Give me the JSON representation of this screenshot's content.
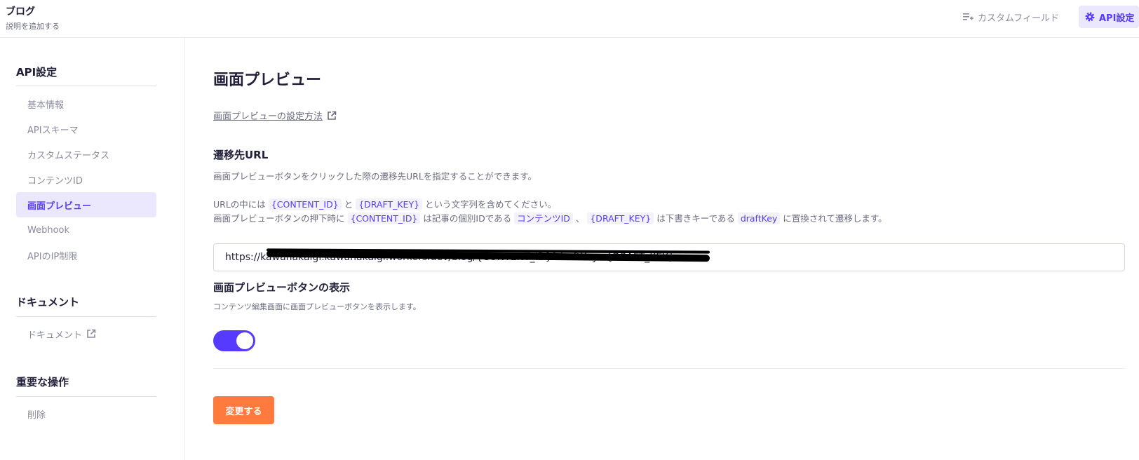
{
  "header": {
    "app_title": "ブログ",
    "app_desc": "説明を追加する",
    "custom_field_label": "カスタムフィールド",
    "api_settings_label": "API設定"
  },
  "sidebar": {
    "sections": [
      {
        "title": "API設定",
        "items": [
          {
            "label": "基本情報",
            "active": false
          },
          {
            "label": "APIスキーマ",
            "active": false
          },
          {
            "label": "カスタムステータス",
            "active": false
          },
          {
            "label": "コンテンツID",
            "active": false
          },
          {
            "label": "画面プレビュー",
            "active": true
          },
          {
            "label": "Webhook",
            "active": false
          },
          {
            "label": "APIのIP制限",
            "active": false
          }
        ]
      },
      {
        "title": "ドキュメント",
        "items": [
          {
            "label": "ドキュメント",
            "active": false,
            "external": true
          }
        ]
      },
      {
        "title": "重要な操作",
        "items": [
          {
            "label": "削除",
            "active": false
          }
        ]
      }
    ]
  },
  "main": {
    "page_title": "画面プレビュー",
    "help_link": "画面プレビューの設定方法",
    "url_section": {
      "title": "遷移先URL",
      "desc": "画面プレビューボタンをクリックした際の遷移先URLを指定することができます。",
      "note1_prefix": "URLの中には",
      "content_id_token": "{CONTENT_ID}",
      "and": "と",
      "draft_key_token": "{DRAFT_KEY}",
      "note1_suffix": "という文字列を含めてください。",
      "note2_prefix": "画面プレビューボタンの押下時に",
      "note2_mid1": "は記事の個別IDである",
      "content_id_label": "コンテンツID",
      "comma": "、",
      "note2_mid2": "は下書きキーである",
      "draft_key_label": "draftKey",
      "note2_suffix": "に置換されて遷移します。",
      "url_value": "https://kawanakaigi.kawanakaigi.workers.dev/blog/{CONTENT_ID}?draftKey={DRAFT_KEY}"
    },
    "button_section": {
      "title": "画面プレビューボタンの表示",
      "desc": "コンテンツ編集画面に画面プレビューボタンを表示します。",
      "toggle_on": true
    },
    "submit_label": "変更する"
  },
  "colors": {
    "accent": "#563bff",
    "accent_bg": "#ebe8fd",
    "submit": "#ff7a3c",
    "text": "#21213b",
    "muted": "#8b8ba0"
  }
}
